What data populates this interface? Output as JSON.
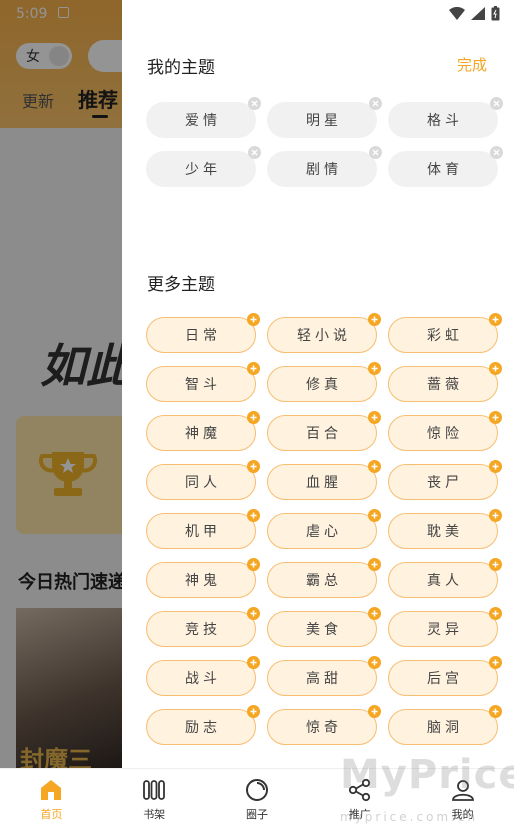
{
  "status_bar": {
    "time": "5:09"
  },
  "background": {
    "gender_label": "女",
    "tabs": [
      {
        "label": "更新"
      },
      {
        "label": "推荐"
      }
    ],
    "banner_text": "如此",
    "hot_section_title": "今日热门速递",
    "cover_title": "封魔三"
  },
  "drawer": {
    "my_topics_title": "我的主题",
    "done_label": "完成",
    "my_topics": [
      {
        "label": "爱情"
      },
      {
        "label": "明星"
      },
      {
        "label": "格斗"
      },
      {
        "label": "少年"
      },
      {
        "label": "剧情"
      },
      {
        "label": "体育"
      }
    ],
    "more_topics_title": "更多主题",
    "more_topics": [
      {
        "label": "日常"
      },
      {
        "label": "轻小说"
      },
      {
        "label": "彩虹"
      },
      {
        "label": "智斗"
      },
      {
        "label": "修真"
      },
      {
        "label": "蔷薇"
      },
      {
        "label": "神魔"
      },
      {
        "label": "百合"
      },
      {
        "label": "惊险"
      },
      {
        "label": "同人"
      },
      {
        "label": "血腥"
      },
      {
        "label": "丧尸"
      },
      {
        "label": "机甲"
      },
      {
        "label": "虐心"
      },
      {
        "label": "耽美"
      },
      {
        "label": "神鬼"
      },
      {
        "label": "霸总"
      },
      {
        "label": "真人"
      },
      {
        "label": "竞技"
      },
      {
        "label": "美食"
      },
      {
        "label": "灵异"
      },
      {
        "label": "战斗"
      },
      {
        "label": "高甜"
      },
      {
        "label": "后宫"
      },
      {
        "label": "励志"
      },
      {
        "label": "惊奇"
      },
      {
        "label": "脑洞"
      }
    ]
  },
  "bottom_nav": [
    {
      "label": "首页",
      "icon": "home-icon",
      "active": true
    },
    {
      "label": "书架",
      "icon": "bookshelf-icon"
    },
    {
      "label": "圈子",
      "icon": "circle-icon"
    },
    {
      "label": "推广",
      "icon": "share-icon"
    },
    {
      "label": "我的",
      "icon": "profile-icon"
    }
  ],
  "watermark": {
    "text": "MyPrice",
    "sub": "myprice.com.cn"
  },
  "colors": {
    "accent": "#f5a623",
    "chip_more_bg": "#fff2df",
    "chip_more_border": "#f7be71",
    "chip_my_bg": "#f1f1f1"
  }
}
